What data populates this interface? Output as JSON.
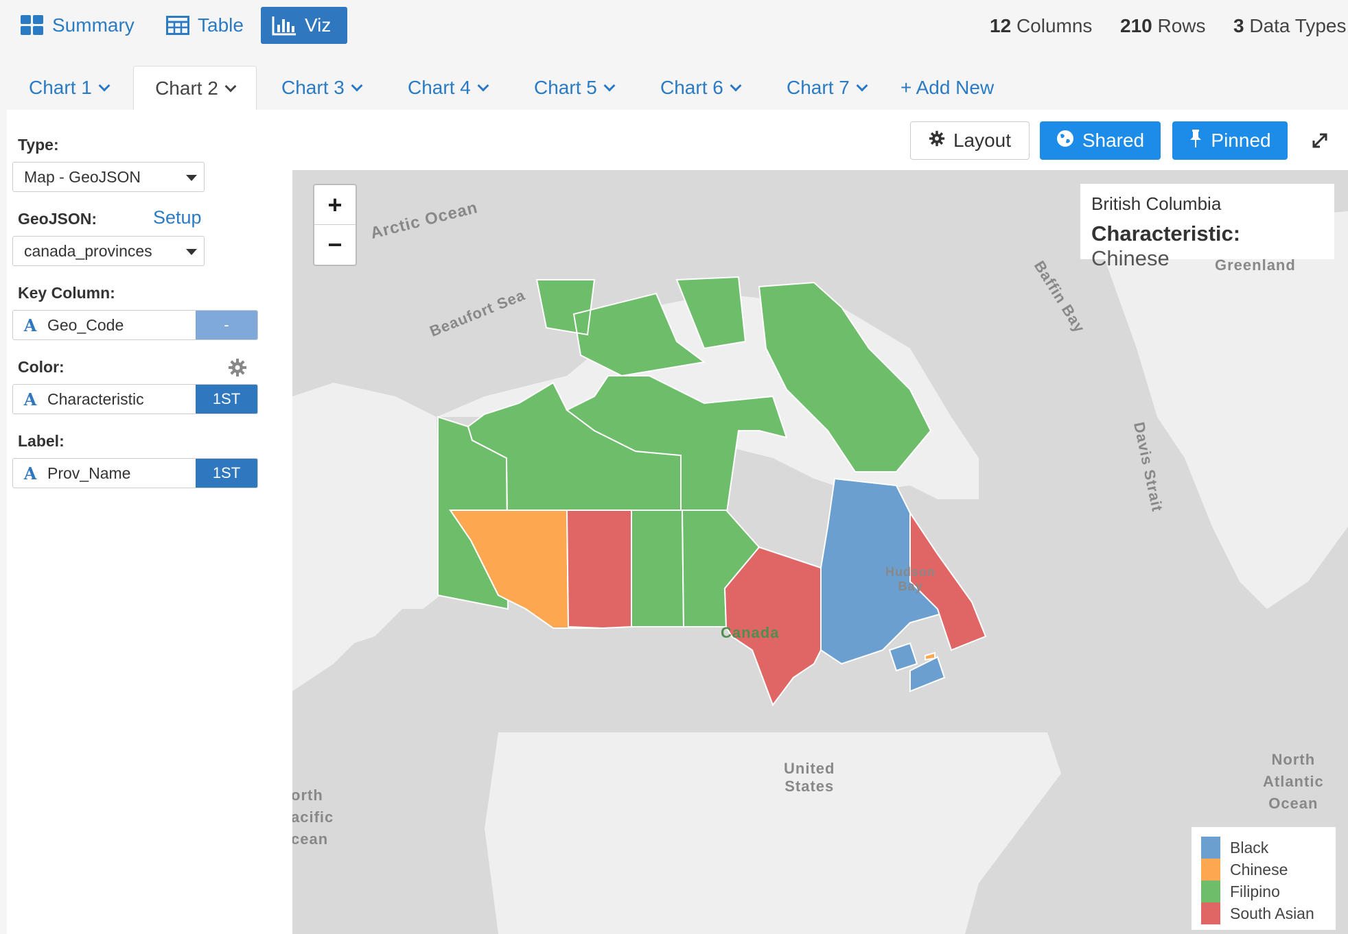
{
  "views": {
    "summary": "Summary",
    "table": "Table",
    "viz": "Viz"
  },
  "stats": {
    "columns_count": "12",
    "columns_label": "Columns",
    "rows_count": "210",
    "rows_label": "Rows",
    "types_count": "3",
    "types_label": "Data Types"
  },
  "tabs": [
    "Chart 1",
    "Chart 2",
    "Chart 3",
    "Chart 4",
    "Chart 5",
    "Chart 6",
    "Chart 7"
  ],
  "add_new": "+ Add New",
  "actions": {
    "layout": "Layout",
    "shared": "Shared",
    "pinned": "Pinned"
  },
  "settings": {
    "type_label": "Type:",
    "type_value": "Map - GeoJSON",
    "geojson_label": "GeoJSON:",
    "setup_link": "Setup",
    "geojson_value": "canada_provinces",
    "key_label": "Key Column:",
    "key_field": "Geo_Code",
    "key_agg": "-",
    "color_label": "Color:",
    "color_field": "Characteristic",
    "color_agg": "1ST",
    "label_label": "Label:",
    "label_field": "Prov_Name",
    "label_agg": "1ST",
    "field_type_icon": "A"
  },
  "map": {
    "zoom_in": "+",
    "zoom_out": "−",
    "place_labels": {
      "arctic_ocean": "Arctic Ocean",
      "beaufort_sea": "Beaufort Sea",
      "baffin_bay": "Baffin Bay",
      "greenland": "Greenland",
      "davis_strait": "Davis Strait",
      "hudson": "Hudson",
      "bay": "Bay",
      "canada": "Canada",
      "united": "United",
      "states": "States",
      "north_pacific_1": "orth",
      "north_pacific_2": "acific",
      "north_pacific_3": "cean",
      "north_atlantic_1": "North",
      "north_atlantic_2": "Atlantic",
      "north_atlantic_3": "Ocean"
    },
    "tooltip": {
      "region": "British Columbia",
      "key": "Characteristic:",
      "value": "Chinese"
    },
    "legend": [
      {
        "label": "Black",
        "color": "#6a9fcf"
      },
      {
        "label": "Chinese",
        "color": "#fda750"
      },
      {
        "label": "Filipino",
        "color": "#6dbd6b"
      },
      {
        "label": "South Asian",
        "color": "#e06666"
      }
    ]
  },
  "chart_data": {
    "type": "choropleth",
    "regions": [
      {
        "name": "Yukon",
        "category": "Filipino"
      },
      {
        "name": "Northwest Territories",
        "category": "Filipino"
      },
      {
        "name": "Nunavut",
        "category": "Filipino"
      },
      {
        "name": "British Columbia",
        "category": "Chinese"
      },
      {
        "name": "Alberta",
        "category": "South Asian"
      },
      {
        "name": "Saskatchewan",
        "category": "Filipino"
      },
      {
        "name": "Manitoba",
        "category": "Filipino"
      },
      {
        "name": "Ontario",
        "category": "South Asian"
      },
      {
        "name": "Quebec",
        "category": "Black"
      },
      {
        "name": "Newfoundland and Labrador",
        "category": "South Asian"
      },
      {
        "name": "New Brunswick",
        "category": "Black"
      },
      {
        "name": "Nova Scotia",
        "category": "Black"
      },
      {
        "name": "Prince Edward Island",
        "category": "Chinese"
      }
    ],
    "legend_position": "bottom-right"
  }
}
